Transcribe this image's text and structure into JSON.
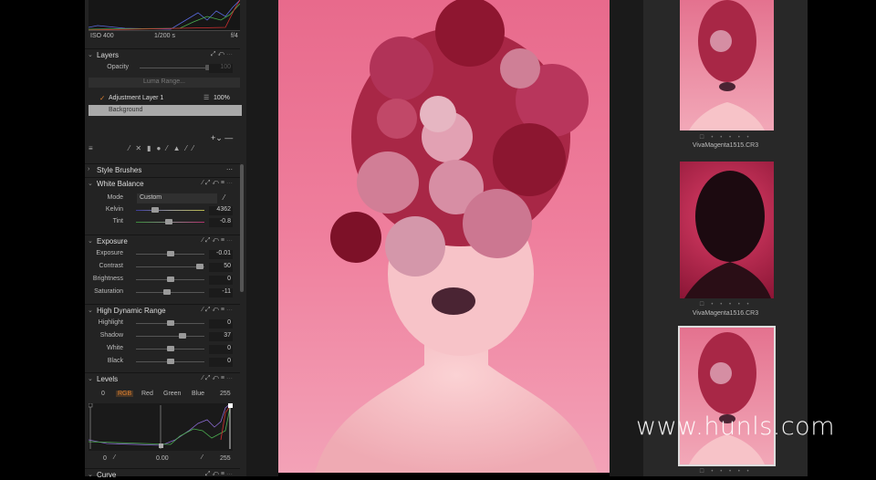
{
  "histogram": {
    "iso": "ISO 400",
    "shutter": "1/200 s",
    "aperture": "f/4"
  },
  "layers": {
    "title": "Layers",
    "opacity_label": "Opacity",
    "opacity_value": "100",
    "luma_range": "Luma Range...",
    "items": [
      {
        "name": "Adjustment Layer 1",
        "opacity": "100%"
      },
      {
        "name": "Background"
      }
    ]
  },
  "style_brushes": {
    "title": "Style Brushes"
  },
  "white_balance": {
    "title": "White Balance",
    "mode_label": "Mode",
    "mode_value": "Custom",
    "rows": [
      {
        "label": "Kelvin",
        "value": "4362",
        "pos": 0.28
      },
      {
        "label": "Tint",
        "value": "-0.8",
        "pos": 0.48
      }
    ]
  },
  "exposure": {
    "title": "Exposure",
    "rows": [
      {
        "label": "Exposure",
        "value": "-0.01",
        "pos": 0.5
      },
      {
        "label": "Contrast",
        "value": "50",
        "pos": 0.93
      },
      {
        "label": "Brightness",
        "value": "0",
        "pos": 0.5
      },
      {
        "label": "Saturation",
        "value": "-11",
        "pos": 0.45
      }
    ]
  },
  "hdr": {
    "title": "High Dynamic Range",
    "rows": [
      {
        "label": "Highlight",
        "value": "0",
        "pos": 0.5
      },
      {
        "label": "Shadow",
        "value": "37",
        "pos": 0.68
      },
      {
        "label": "White",
        "value": "0",
        "pos": 0.5
      },
      {
        "label": "Black",
        "value": "0",
        "pos": 0.5
      }
    ]
  },
  "levels": {
    "title": "Levels",
    "low": "0",
    "high": "255",
    "channels": [
      "RGB",
      "Red",
      "Green",
      "Blue"
    ],
    "out_low": "0",
    "mid": "0.00",
    "out_high": "255"
  },
  "curve": {
    "title": "Curve"
  },
  "filmstrip": {
    "items": [
      {
        "name": "VivaMagenta1515.CR3"
      },
      {
        "name": "VivaMagenta1516.CR3"
      }
    ]
  },
  "watermark": "www.hunls.com",
  "colors": {
    "accent": "#e0812f",
    "panel": "#232323"
  }
}
